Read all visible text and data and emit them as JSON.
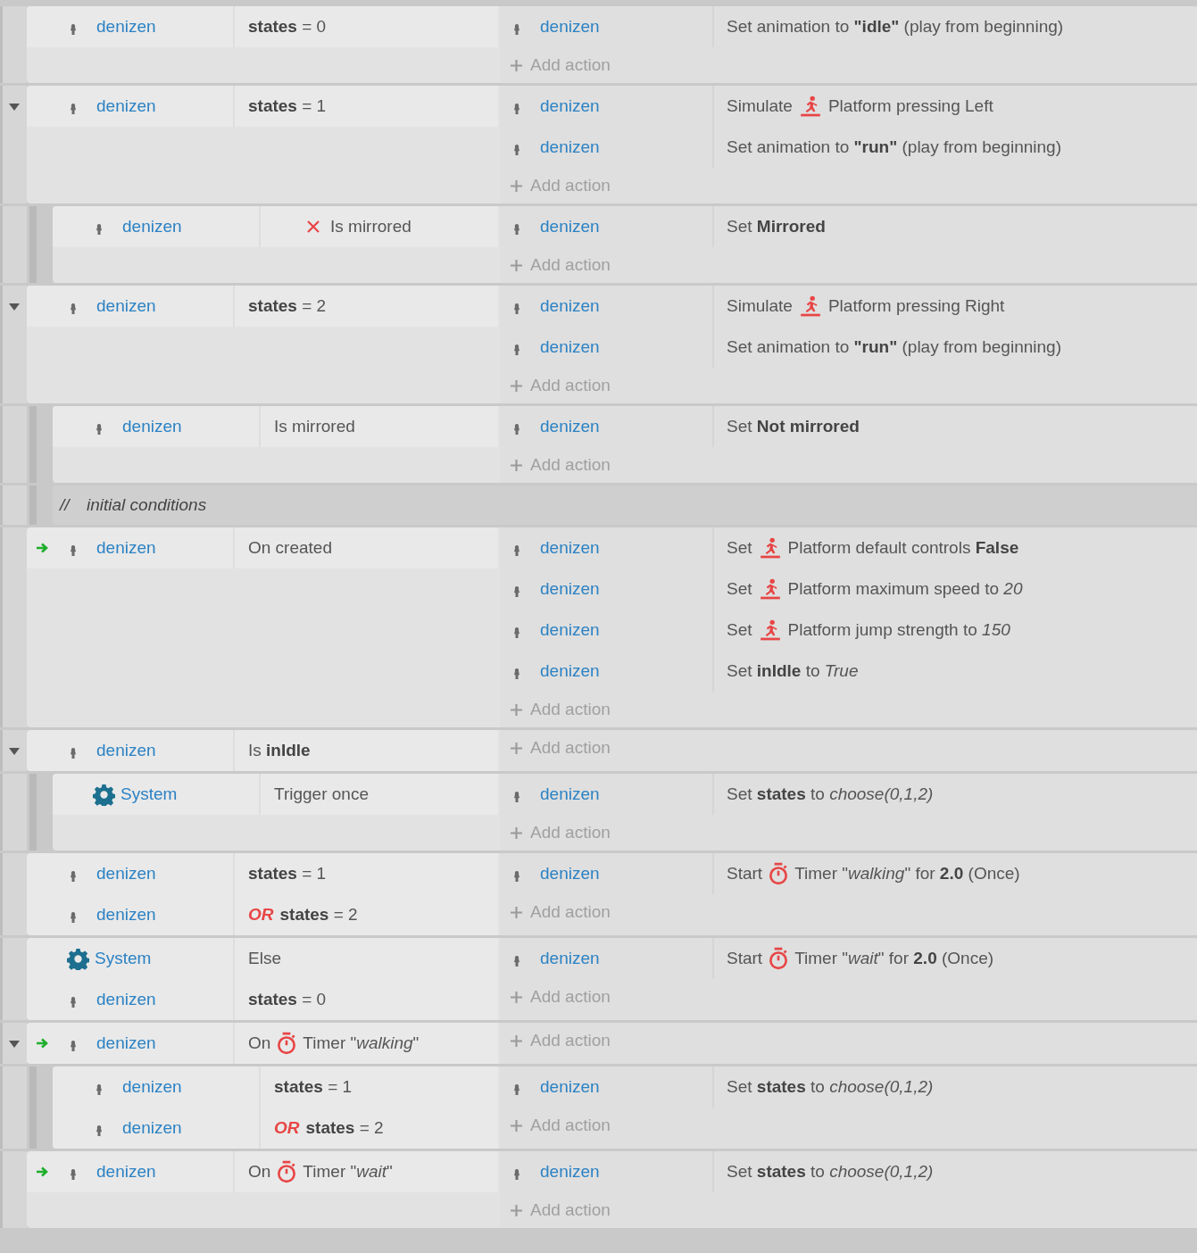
{
  "events": [
    {
      "conditions": [
        {
          "object": "denizen",
          "kind": "object",
          "trigger": false,
          "inverted": false,
          "text": "**states** = 0"
        }
      ],
      "actions": [
        {
          "object": "denizen",
          "kind": "plain",
          "text": "Set animation to **\"idle\"** (play from beginning)"
        }
      ],
      "add_action": "Add action"
    },
    {
      "expanded": true,
      "conditions": [
        {
          "object": "denizen",
          "kind": "object",
          "trigger": false,
          "inverted": false,
          "text": "**states** = 1"
        }
      ],
      "actions": [
        {
          "object": "denizen",
          "kind": "platform",
          "pre": "Simulate",
          "text": "Platform pressing Left"
        },
        {
          "object": "denizen",
          "kind": "plain",
          "text": "Set animation to **\"run\"** (play from beginning)"
        }
      ],
      "add_action": "Add action",
      "children": [
        {
          "conditions": [
            {
              "object": "denizen",
              "kind": "object",
              "trigger": false,
              "inverted": true,
              "text": "Is mirrored"
            }
          ],
          "actions": [
            {
              "object": "denizen",
              "kind": "plain",
              "text": "Set **Mirrored**"
            }
          ],
          "add_action": "Add action"
        }
      ]
    },
    {
      "expanded": true,
      "conditions": [
        {
          "object": "denizen",
          "kind": "object",
          "trigger": false,
          "inverted": false,
          "text": "**states** = 2"
        }
      ],
      "actions": [
        {
          "object": "denizen",
          "kind": "platform",
          "pre": "Simulate",
          "text": "Platform pressing Right"
        },
        {
          "object": "denizen",
          "kind": "plain",
          "text": "Set animation to **\"run\"** (play from beginning)"
        }
      ],
      "add_action": "Add action",
      "children": [
        {
          "conditions": [
            {
              "object": "denizen",
              "kind": "object",
              "trigger": false,
              "inverted": false,
              "text": "Is mirrored"
            }
          ],
          "actions": [
            {
              "object": "denizen",
              "kind": "plain",
              "text": "Set **Not mirrored**"
            }
          ],
          "add_action": "Add action"
        },
        {
          "kind": "comment",
          "marker": "//",
          "text": "initial conditions"
        }
      ]
    },
    {
      "conditions": [
        {
          "object": "denizen",
          "kind": "object",
          "trigger": true,
          "inverted": false,
          "text": "On created"
        }
      ],
      "actions": [
        {
          "object": "denizen",
          "kind": "platform",
          "pre": "Set",
          "text": "Platform default controls **False**"
        },
        {
          "object": "denizen",
          "kind": "platform",
          "pre": "Set",
          "text": "Platform maximum speed to *20*"
        },
        {
          "object": "denizen",
          "kind": "platform",
          "pre": "Set",
          "text": "Platform jump strength to *150*"
        },
        {
          "object": "denizen",
          "kind": "plain",
          "text": "Set **inIdle** to *True*"
        }
      ],
      "add_action": "Add action"
    },
    {
      "expanded": true,
      "conditions": [
        {
          "object": "denizen",
          "kind": "object",
          "trigger": false,
          "inverted": false,
          "text": "Is **inIdle**"
        }
      ],
      "add_action": "Add action",
      "children": [
        {
          "conditions": [
            {
              "object": "System",
              "kind": "system",
              "trigger": false,
              "inverted": false,
              "text": "Trigger once"
            }
          ],
          "actions": [
            {
              "object": "denizen",
              "kind": "plain",
              "text": "Set **states** to *choose(0,1,2)*"
            }
          ],
          "add_action": "Add action"
        }
      ]
    },
    {
      "conditions": [
        {
          "object": "denizen",
          "kind": "object",
          "trigger": false,
          "inverted": false,
          "text": "**states** = 1"
        },
        {
          "object": "denizen",
          "kind": "object",
          "trigger": false,
          "inverted": false,
          "or": "OR",
          "text": "**states** = 2"
        }
      ],
      "actions": [
        {
          "object": "denizen",
          "kind": "timer",
          "pre": "Start",
          "text": "Timer \"*walking*\" for **2.0** (Once)"
        }
      ],
      "add_action": "Add action"
    },
    {
      "conditions": [
        {
          "object": "System",
          "kind": "system",
          "trigger": false,
          "inverted": false,
          "text": "Else"
        },
        {
          "object": "denizen",
          "kind": "object",
          "trigger": false,
          "inverted": false,
          "text": "**states** = 0"
        }
      ],
      "actions": [
        {
          "object": "denizen",
          "kind": "timer",
          "pre": "Start",
          "text": "Timer \"*wait*\" for **2.0** (Once)"
        }
      ],
      "add_action": "Add action"
    },
    {
      "expanded": true,
      "conditions": [
        {
          "object": "denizen",
          "kind": "timer",
          "trigger": true,
          "inverted": false,
          "pre": "On",
          "text": "Timer \"*walking*\""
        }
      ],
      "add_action": "Add action",
      "children": [
        {
          "conditions": [
            {
              "object": "denizen",
              "kind": "object",
              "trigger": false,
              "inverted": false,
              "text": "**states** = 1"
            },
            {
              "object": "denizen",
              "kind": "object",
              "trigger": false,
              "inverted": false,
              "or": "OR",
              "text": "**states** = 2"
            }
          ],
          "actions": [
            {
              "object": "denizen",
              "kind": "plain",
              "text": "Set **states** to *choose(0,1,2)*"
            }
          ],
          "add_action": "Add action"
        }
      ]
    },
    {
      "conditions": [
        {
          "object": "denizen",
          "kind": "timer",
          "trigger": true,
          "inverted": false,
          "pre": "On",
          "text": "Timer \"*wait*\""
        }
      ],
      "actions": [
        {
          "object": "denizen",
          "kind": "plain",
          "text": "Set **states** to *choose(0,1,2)*"
        }
      ],
      "add_action": "Add action"
    }
  ]
}
